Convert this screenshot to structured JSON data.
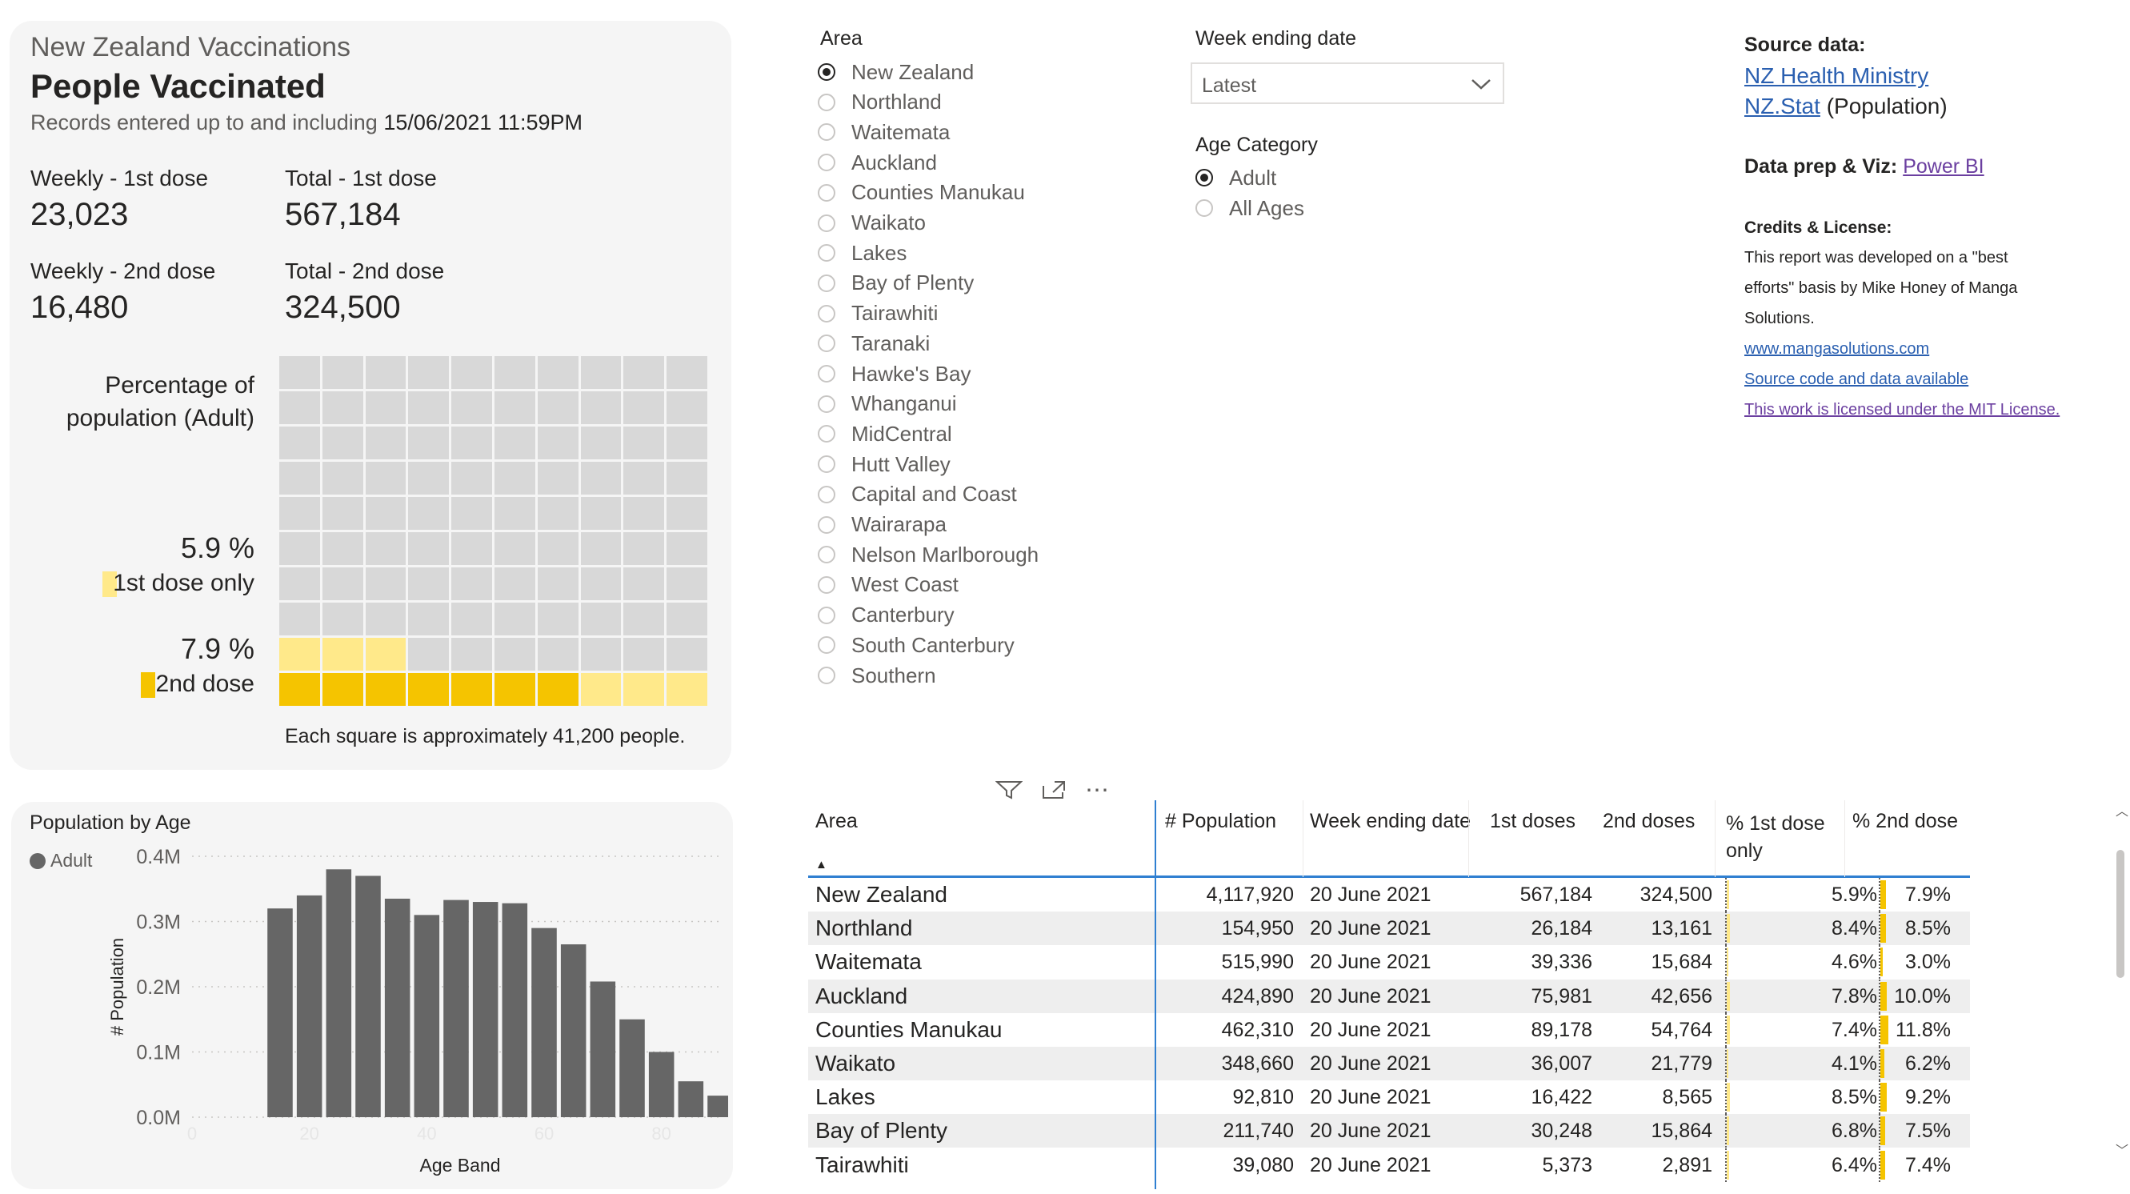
{
  "summary": {
    "subtitle": "New Zealand Vaccinations",
    "title": "People Vaccinated",
    "records_prefix": "Records entered up to and including",
    "records_date": "15/06/2021 11:59PM",
    "weekly_1st_label": "Weekly - 1st dose",
    "weekly_1st_value": "23,023",
    "total_1st_label": "Total - 1st dose",
    "total_1st_value": "567,184",
    "weekly_2nd_label": "Weekly - 2nd dose",
    "weekly_2nd_value": "16,480",
    "total_2nd_label": "Total - 2nd dose",
    "total_2nd_value": "324,500"
  },
  "waffle": {
    "pct_label_line1": "Percentage of",
    "pct_label_line2": "population (Adult)",
    "first_only_pct": "5.9 %",
    "first_only_label": "1st dose only",
    "second_pct": "7.9 %",
    "second_label": "2nd dose",
    "footnote": "Each square is approximately 41,200 people.",
    "rows": 10,
    "cols": 10,
    "second_dose_squares": 7,
    "first_only_squares": 6,
    "colors": {
      "empty": "#d8d8d8",
      "second": "#f5c400",
      "first_only": "#ffe98a"
    }
  },
  "area_slicer": {
    "title": "Area",
    "selected": "New Zealand",
    "options": [
      "New Zealand",
      "Northland",
      "Waitemata",
      "Auckland",
      "Counties Manukau",
      "Waikato",
      "Lakes",
      "Bay of Plenty",
      "Tairawhiti",
      "Taranaki",
      "Hawke's Bay",
      "Whanganui",
      "MidCentral",
      "Hutt Valley",
      "Capital and Coast",
      "Wairarapa",
      "Nelson Marlborough",
      "West Coast",
      "Canterbury",
      "South Canterbury",
      "Southern"
    ]
  },
  "week_slicer": {
    "title": "Week ending date",
    "value": "Latest"
  },
  "age_slicer": {
    "title": "Age Category",
    "selected": "Adult",
    "options": [
      "Adult",
      "All Ages"
    ]
  },
  "sources": {
    "source_title": "Source data:",
    "link1": "NZ Health Ministry",
    "link2": "NZ.Stat",
    "link2_suffix": "(Population)",
    "dataprep_label": "Data prep & Viz:",
    "dataprep_link": "Power BI",
    "credits_title": "Credits & License:",
    "credits_text_1": "This report was developed on a \"best",
    "credits_text_2": "efforts\" basis by Mike Honey of Manga",
    "credits_text_3": "Solutions.",
    "credits_link1": "www.mangasolutions.com",
    "credits_link2": "Source code and data available",
    "credits_link3": "This work is licensed under the MIT License."
  },
  "chart_data": {
    "type": "bar",
    "title": "Population by Age",
    "legend": [
      "Adult"
    ],
    "xlabel": "Age Band",
    "ylabel": "# Population",
    "y_ticks": [
      "0.0M",
      "0.1M",
      "0.2M",
      "0.3M",
      "0.4M"
    ],
    "x_ticks": [
      "0",
      "20",
      "40",
      "60",
      "80"
    ],
    "ylim": [
      0,
      0.4
    ],
    "xlim": [
      0,
      90
    ],
    "unit": "M",
    "x": [
      15,
      20,
      25,
      30,
      35,
      40,
      45,
      50,
      55,
      60,
      65,
      70,
      75,
      80,
      85,
      90
    ],
    "values": [
      0.32,
      0.34,
      0.38,
      0.37,
      0.335,
      0.31,
      0.333,
      0.33,
      0.328,
      0.29,
      0.265,
      0.208,
      0.15,
      0.1,
      0.055,
      0.033
    ],
    "color": "#666666"
  },
  "visual_header": {
    "filter_icon": "filter-icon",
    "focus_icon": "focus-mode-icon",
    "more_icon": "more-options-icon"
  },
  "table": {
    "headers": {
      "area": "Area",
      "population": "# Population",
      "week": "Week ending date",
      "first": "1st doses",
      "second": "2nd doses",
      "pct_first_1": "% 1st dose",
      "pct_first_2": "only",
      "pct_second": "% 2nd dose"
    },
    "sort_indicator": "▲",
    "rows": [
      {
        "area": "New Zealand",
        "population": "4,117,920",
        "week": "20 June 2021",
        "first": "567,184",
        "second": "324,500",
        "pct_first": "5.9%",
        "pct_first_v": 5.9,
        "pct_second": "7.9%",
        "pct_second_v": 7.9
      },
      {
        "area": "Northland",
        "population": "154,950",
        "week": "20 June 2021",
        "first": "26,184",
        "second": "13,161",
        "pct_first": "8.4%",
        "pct_first_v": 8.4,
        "pct_second": "8.5%",
        "pct_second_v": 8.5
      },
      {
        "area": "Waitemata",
        "population": "515,990",
        "week": "20 June 2021",
        "first": "39,336",
        "second": "15,684",
        "pct_first": "4.6%",
        "pct_first_v": 4.6,
        "pct_second": "3.0%",
        "pct_second_v": 3.0
      },
      {
        "area": "Auckland",
        "population": "424,890",
        "week": "20 June 2021",
        "first": "75,981",
        "second": "42,656",
        "pct_first": "7.8%",
        "pct_first_v": 7.8,
        "pct_second": "10.0%",
        "pct_second_v": 10.0
      },
      {
        "area": "Counties Manukau",
        "population": "462,310",
        "week": "20 June 2021",
        "first": "89,178",
        "second": "54,764",
        "pct_first": "7.4%",
        "pct_first_v": 7.4,
        "pct_second": "11.8%",
        "pct_second_v": 11.8
      },
      {
        "area": "Waikato",
        "population": "348,660",
        "week": "20 June 2021",
        "first": "36,007",
        "second": "21,779",
        "pct_first": "4.1%",
        "pct_first_v": 4.1,
        "pct_second": "6.2%",
        "pct_second_v": 6.2
      },
      {
        "area": "Lakes",
        "population": "92,810",
        "week": "20 June 2021",
        "first": "16,422",
        "second": "8,565",
        "pct_first": "8.5%",
        "pct_first_v": 8.5,
        "pct_second": "9.2%",
        "pct_second_v": 9.2
      },
      {
        "area": "Bay of Plenty",
        "population": "211,740",
        "week": "20 June 2021",
        "first": "30,248",
        "second": "15,864",
        "pct_first": "6.8%",
        "pct_first_v": 6.8,
        "pct_second": "7.5%",
        "pct_second_v": 7.5
      },
      {
        "area": "Tairawhiti",
        "population": "39,080",
        "week": "20 June 2021",
        "first": "5,373",
        "second": "2,891",
        "pct_first": "6.4%",
        "pct_first_v": 6.4,
        "pct_second": "7.4%",
        "pct_second_v": 7.4
      }
    ]
  }
}
